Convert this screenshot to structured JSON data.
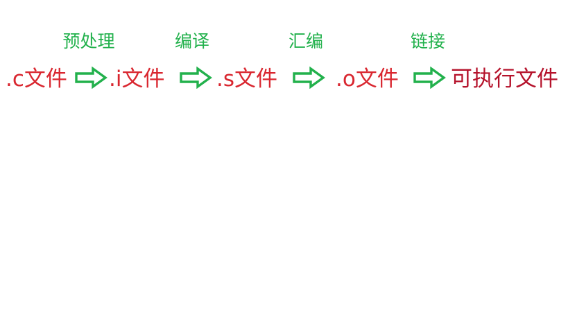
{
  "colors": {
    "stage": "#22b14c",
    "file": "#d9262f",
    "final": "#b5122b",
    "arrow": "#22b14c"
  },
  "stages": [
    {
      "label": "预处理"
    },
    {
      "label": "编译"
    },
    {
      "label": "汇编"
    },
    {
      "label": "链接"
    }
  ],
  "files": [
    {
      "label": ".c文件"
    },
    {
      "label": ".i文件"
    },
    {
      "label": ".s文件"
    },
    {
      "label": ".o文件"
    },
    {
      "label": "可执行文件"
    }
  ],
  "arrow_icon": "right-arrow-outline-icon"
}
